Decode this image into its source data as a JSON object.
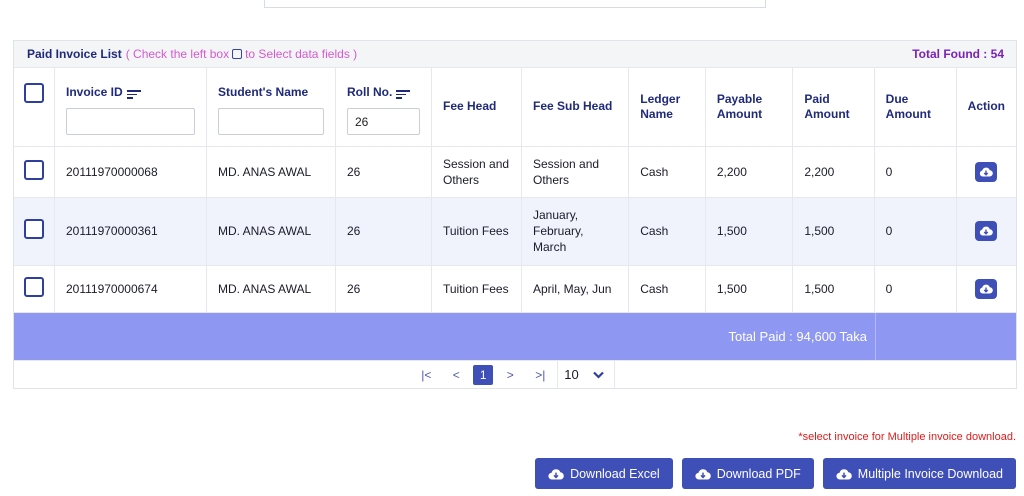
{
  "panel": {
    "title": "Paid Invoice List",
    "hint_before": "( Check the left box",
    "hint_after": "to Select data fields )",
    "total_found": "Total Found : 54"
  },
  "columns": {
    "invoice_id": "Invoice ID",
    "student_name": "Student's Name",
    "roll_no": "Roll No.",
    "fee_head": "Fee Head",
    "fee_sub_head": "Fee Sub Head",
    "ledger_name": "Ledger Name",
    "payable_amount": "Payable Amount",
    "paid_amount": "Paid Amount",
    "due_amount": "Due Amount",
    "action": "Action"
  },
  "filters": {
    "invoice_id": "",
    "student_name": "",
    "roll_no": "26"
  },
  "rows": [
    {
      "invoice_id": "20111970000068",
      "student_name": "MD. ANAS AWAL",
      "roll_no": "26",
      "fee_head": "Session and Others",
      "fee_sub_head": "Session and Others",
      "ledger_name": "Cash",
      "payable": "2,200",
      "paid": "2,200",
      "due": "0"
    },
    {
      "invoice_id": "20111970000361",
      "student_name": "MD. ANAS AWAL",
      "roll_no": "26",
      "fee_head": "Tuition Fees",
      "fee_sub_head": "January, February, March",
      "ledger_name": "Cash",
      "payable": "1,500",
      "paid": "1,500",
      "due": "0"
    },
    {
      "invoice_id": "20111970000674",
      "student_name": "MD. ANAS AWAL",
      "roll_no": "26",
      "fee_head": "Tuition Fees",
      "fee_sub_head": "April, May, Jun",
      "ledger_name": "Cash",
      "payable": "1,500",
      "paid": "1,500",
      "due": "0"
    }
  ],
  "total_paid": "Total Paid : 94,600 Taka",
  "pagination": {
    "first": "|<",
    "prev": "<",
    "current": "1",
    "next": ">",
    "last": ">|",
    "page_size": "10"
  },
  "note": "*select invoice for Multiple invoice download.",
  "buttons": {
    "excel": "Download Excel",
    "pdf": "Download PDF",
    "multiple": "Multiple Invoice Download"
  },
  "icons": {
    "download": "cloud-download-icon",
    "sort": "sort-icon",
    "dropdown": "chevron-down-icon"
  },
  "colors": {
    "primary": "#3f4fb8",
    "total_row": "#8e97f2",
    "hint": "#d55ad0",
    "total_found": "#7a22b8",
    "note": "#e01a1a"
  }
}
